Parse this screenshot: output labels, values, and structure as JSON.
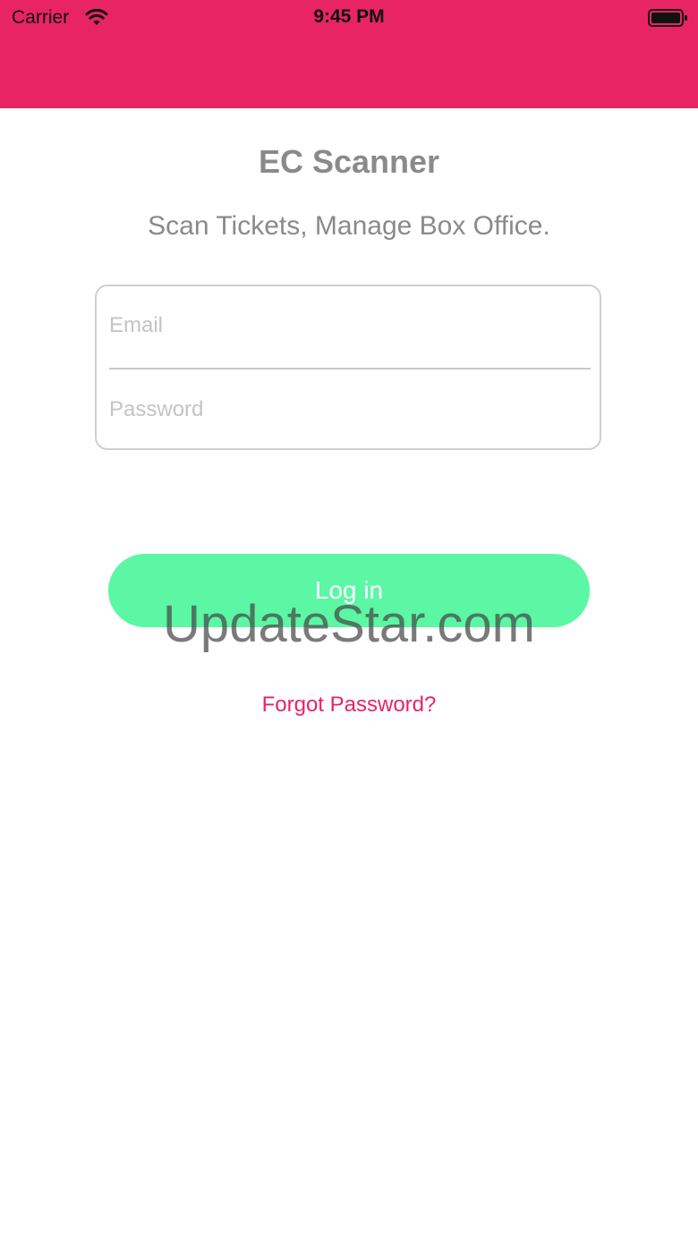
{
  "status_bar": {
    "carrier": "Carrier",
    "time": "9:45 PM",
    "wifi_icon": "wifi-icon",
    "battery_icon": "battery-icon"
  },
  "header": {
    "color": "#e82465"
  },
  "app": {
    "title": "EC Scanner",
    "tagline": "Scan Tickets, Manage Box Office."
  },
  "form": {
    "email": {
      "value": "",
      "placeholder": "Email"
    },
    "password": {
      "value": "",
      "placeholder": "Password"
    }
  },
  "login_button": {
    "label": "Log in",
    "color": "#5cf7a4"
  },
  "forgot_password": {
    "label": "Forgot Password?",
    "color": "#e82465"
  },
  "watermark": {
    "text": "UpdateStar.com"
  }
}
